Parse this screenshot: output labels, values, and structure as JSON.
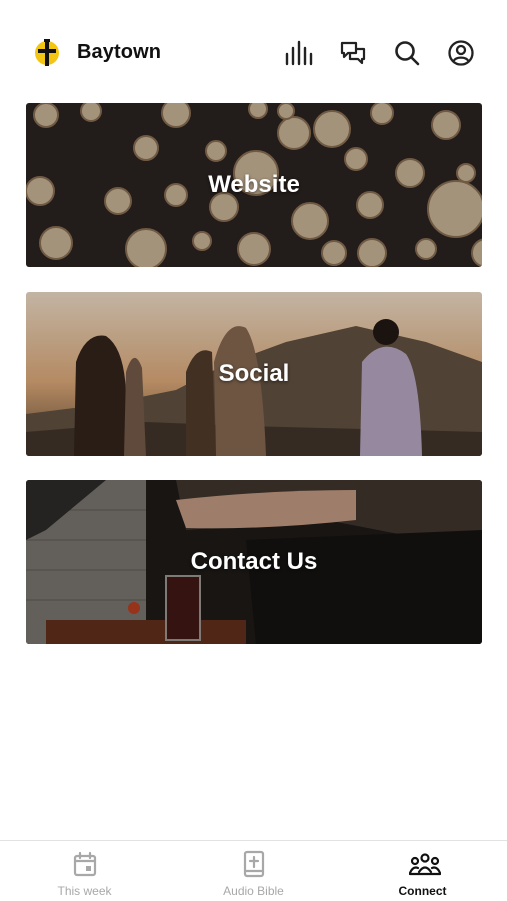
{
  "header": {
    "church_name": "Baytown",
    "icons": [
      "logo-cross-icon",
      "audio-bars-icon",
      "chat-icon",
      "search-icon",
      "profile-icon"
    ]
  },
  "cards": [
    {
      "label": "Website",
      "image": "log-pile-photo"
    },
    {
      "label": "Social",
      "image": "friends-sunset-photo"
    },
    {
      "label": "Contact Us",
      "image": "cafe-table-photo"
    }
  ],
  "tabbar": {
    "tabs": [
      {
        "label": "This week",
        "icon": "calendar-icon",
        "active": false
      },
      {
        "label": "Audio Bible",
        "icon": "bible-icon",
        "active": false
      },
      {
        "label": "Connect",
        "icon": "people-group-icon",
        "active": true
      }
    ]
  },
  "colors": {
    "logo_yellow": "#f4c614",
    "inactive_tab": "#a8a8a8",
    "active_tab": "#111111"
  }
}
